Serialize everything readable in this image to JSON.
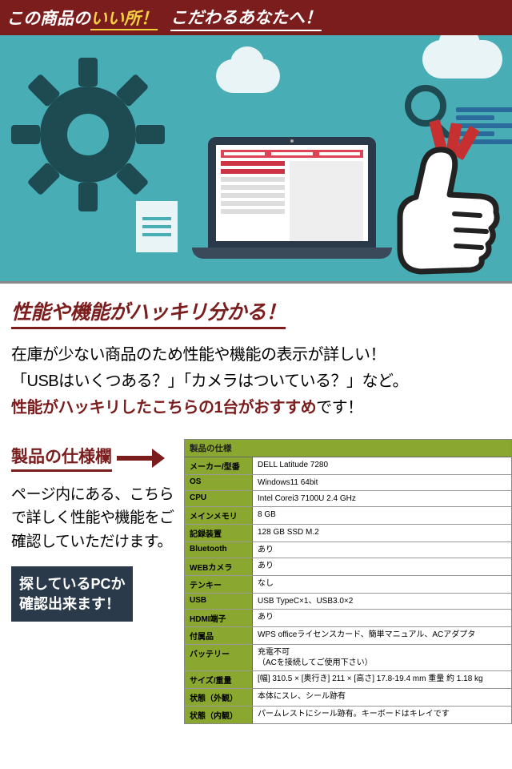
{
  "header": {
    "prefix": "この商品の",
    "highlight": "いい所！",
    "tagline": "こだわるあなたへ！"
  },
  "section1": {
    "title": "性能や機能がハッキリ分かる！",
    "line1": "在庫が少ない商品のため性能や機能の表示が詳しい！",
    "line2": "「USBはいくつある？」「カメラはついている？」など。",
    "line3a": "性能がハッキリしたこちらの1台がおすすめ",
    "line3b": "です！"
  },
  "spec": {
    "label": "製品の仕様欄",
    "desc": "ページ内にある、こちらで詳しく性能や機能をご確認していただけます。",
    "cta_l1": "探しているPCか",
    "cta_l2": "確認出来ます！",
    "table_header": "製品の仕様",
    "rows": [
      {
        "k": "メーカー/型番",
        "v": "DELL Latitude 7280"
      },
      {
        "k": "OS",
        "v": "Windows11 64bit"
      },
      {
        "k": "CPU",
        "v": "Intel Corei3 7100U 2.4 GHz"
      },
      {
        "k": "メインメモリ",
        "v": "8 GB"
      },
      {
        "k": "記録装置",
        "v": "128 GB SSD M.2"
      },
      {
        "k": "Bluetooth",
        "v": "あり"
      },
      {
        "k": "WEBカメラ",
        "v": "あり"
      },
      {
        "k": "テンキー",
        "v": "なし"
      },
      {
        "k": "USB",
        "v": "USB TypeC×1、USB3.0×2"
      },
      {
        "k": "HDMI端子",
        "v": "あり"
      },
      {
        "k": "付属品",
        "v": "WPS officeライセンスカード、簡単マニュアル、ACアダプタ"
      },
      {
        "k": "バッテリー",
        "v": "充電不可\n（ACを接続してご使用下さい）"
      },
      {
        "k": "サイズ/重量",
        "v": "[幅] 310.5 × [奥行き] 211 × [高さ] 17.8-19.4 mm 重量 約 1.18 kg"
      },
      {
        "k": "状態（外観）",
        "v": "本体にスレ、シール跡有"
      },
      {
        "k": "状態（内観）",
        "v": "パームレストにシール跡有。キーボードはキレイです"
      }
    ]
  }
}
